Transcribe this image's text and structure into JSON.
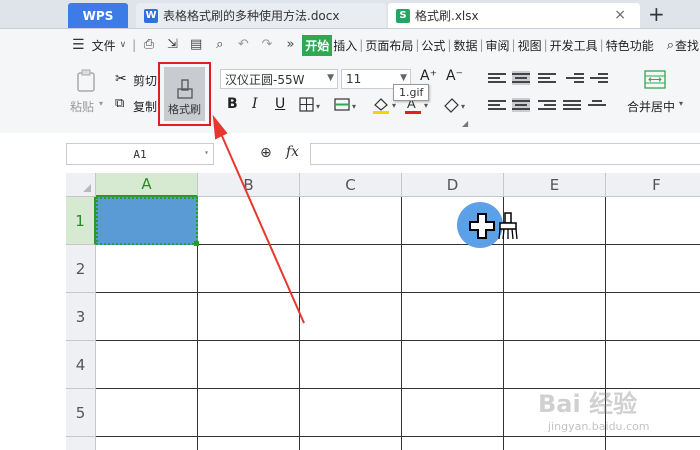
{
  "tabs": {
    "app": "WPS",
    "doc_title": "表格格式刷的多种使用方法.docx",
    "sheet_title": "格式刷.xlsx",
    "close": "×",
    "add": "+"
  },
  "menu": {
    "file": "文件",
    "items": [
      "开始",
      "插入",
      "页面布局",
      "公式",
      "数据",
      "审阅",
      "视图",
      "开发工具",
      "特色功能"
    ],
    "search": "查找"
  },
  "ribbon": {
    "paste": "粘贴",
    "cut": "剪切",
    "copy": "复制",
    "format_painter": "格式刷",
    "font_name": "汉仪正圆-55W",
    "font_size": "11",
    "bold": "B",
    "italic": "I",
    "underline": "U",
    "merge_center": "合并居中",
    "tooltip": "1.gif",
    "font_up": "A⁺",
    "font_down": "A⁻"
  },
  "formula_bar": {
    "cell_ref": "A1",
    "fx": "fx",
    "value": ""
  },
  "sheet": {
    "columns": [
      "A",
      "B",
      "C",
      "D",
      "E",
      "F"
    ],
    "rows": [
      "1",
      "2",
      "3",
      "4",
      "5"
    ],
    "selected_cell": "A1",
    "selected_fill": "#5b9bd5"
  },
  "watermark": {
    "main": "Bai 经验",
    "sub": "jingyan.baidu.com"
  }
}
